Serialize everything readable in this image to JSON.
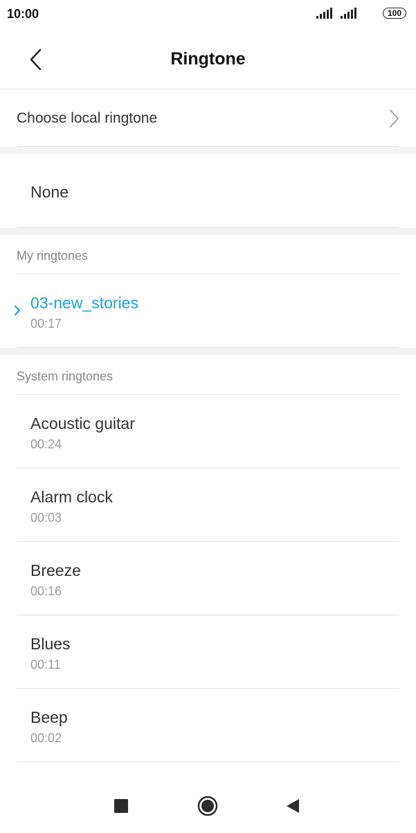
{
  "status_bar": {
    "time": "10:00",
    "battery": "100"
  },
  "header": {
    "title": "Ringtone",
    "back_icon": "back-chevron-icon"
  },
  "local": {
    "label": "Choose local ringtone"
  },
  "none_option": {
    "label": "None"
  },
  "my_ringtones": {
    "header": "My ringtones",
    "items": [
      {
        "name": "03-new_stories",
        "duration": "00:17",
        "selected": true
      }
    ]
  },
  "system_ringtones": {
    "header": "System ringtones",
    "items": [
      {
        "name": "Acoustic guitar",
        "duration": "00:24"
      },
      {
        "name": "Alarm clock",
        "duration": "00:03"
      },
      {
        "name": "Breeze",
        "duration": "00:16"
      },
      {
        "name": "Blues",
        "duration": "00:11"
      },
      {
        "name": "Beep",
        "duration": "00:02"
      }
    ]
  },
  "colors": {
    "accent": "#1aa3d6",
    "divider": "#e3e3e3",
    "section_gap": "#f4f4f4"
  },
  "nav": {
    "icons": [
      "recents-square-icon",
      "home-circle-icon",
      "back-triangle-icon"
    ]
  }
}
